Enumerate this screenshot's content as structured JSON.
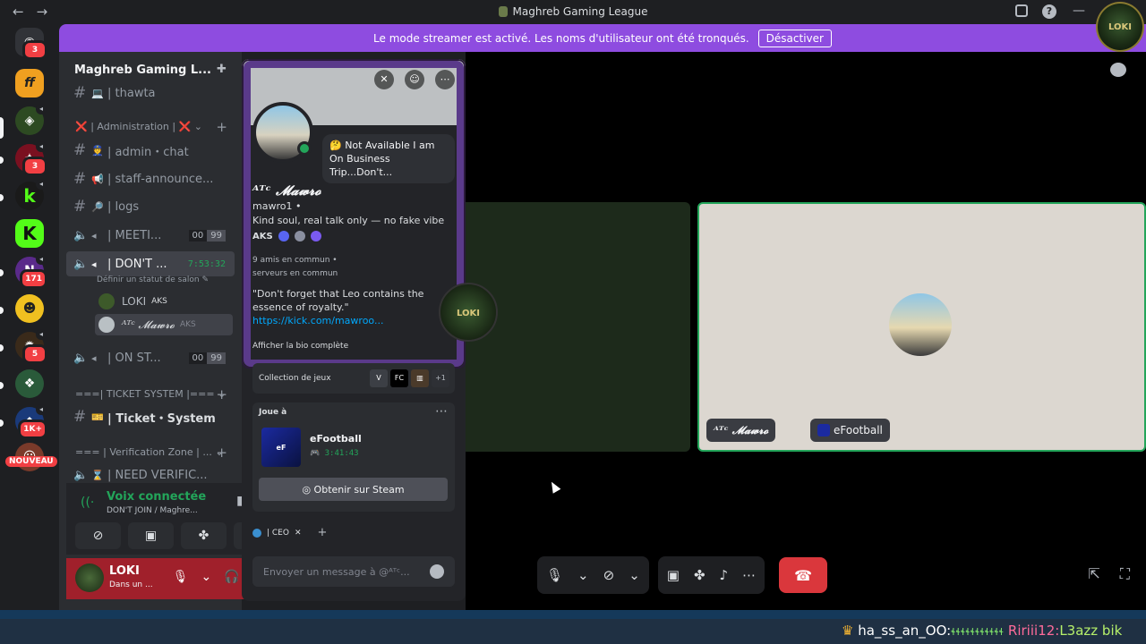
{
  "window": {
    "title": "Maghreb Gaming League",
    "back_icon": "←",
    "forward_icon": "→",
    "minimize_icon": "—"
  },
  "banner": {
    "message": "Le mode streamer est activé. Les noms d'utilisateur ont été tronqués.",
    "button": "Désactiver",
    "color": "#8e4ce0"
  },
  "rail": {
    "home_badge": "3",
    "badges": {
      "s3": "3",
      "s7": "171",
      "s9": "5",
      "s11": "1K+"
    },
    "new_label": "NOUVEAU"
  },
  "server": {
    "name": "Maghreb Gaming L...",
    "categories": {
      "admin": "❌ | Administration | ❌",
      "ticket": "===| TICKET SYSTEM |===",
      "verify": "=== | Verification Zone | ..."
    },
    "channels": {
      "thawta": "| thawta",
      "admin_chat": "| admin・chat",
      "staff": "| staff-announce...",
      "logs": "| logs",
      "meeting": "| MEETI...",
      "dont_join": "| DON'T ...",
      "dont_join_timer": "7:53:32",
      "dont_join_status": "Définir un statut de salon",
      "on_st": "| ON ST...",
      "ticket": "| Ticket・System",
      "need_verif": "| NEED VERIFIC..."
    },
    "counter_a": "00",
    "counter_b": "99",
    "voice_users": [
      {
        "name": "LOKI",
        "tag": "AKS"
      },
      {
        "name": "ᴬᵀᶜ 𝓜𝓪𝔀𝓻𝓸",
        "tag": "AKS"
      }
    ]
  },
  "voice": {
    "title": "Voix connectée",
    "subtitle": "DON'T JOIN / Maghre..."
  },
  "user": {
    "name": "LOKI",
    "status": "Dans un ..."
  },
  "profile": {
    "status": "Not Available I am On Business Trip...Don't...",
    "display_name": "ᴬᵀᶜ 𝓜𝓪𝔀𝓻𝓸",
    "handle": "mawro1 •",
    "tagline": "Kind soul, real talk only — no fake vibe",
    "guild_tag": "AKS",
    "mutual_friends": "9 amis en commun  •",
    "mutual_servers": "serveurs en commun",
    "quote": "\"Don't forget that Leo contains the essence of royalty.\"",
    "link": "https://kick.com/mawroo...",
    "full_bio": "Afficher la bio complète",
    "collection_label": "Collection de jeux",
    "collection_more": "+1",
    "playing_label": "Joue à",
    "game_name": "eFootball",
    "game_time": "3:41:43",
    "steam_button": "Obtenir sur Steam",
    "role": "| CEO",
    "message_placeholder": "Envoyer un message à @ᴬᵀᶜ..."
  },
  "stage": {
    "tile_name": "ᴬᵀᶜ 𝓜𝓪𝔀𝓻𝓸",
    "tile_game": "eFootball"
  },
  "ticker": {
    "user1": "ha_ss_an_OO:",
    "msg1": "ɬɬɬɬɬɬɬɬɬɬɬ",
    "user2": "Ririii12:",
    "msg2": "L3azz bik"
  }
}
